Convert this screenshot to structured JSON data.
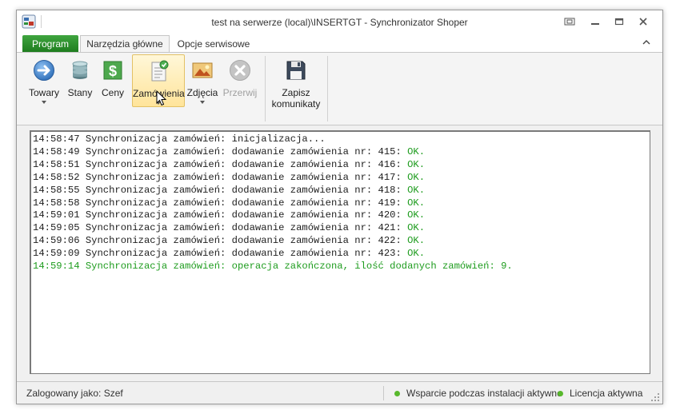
{
  "window": {
    "title": "test na serwerze (local)\\INSERTGT - Synchronizator Shoper"
  },
  "tabs": {
    "program": "Program",
    "main": "Narzędzia główne",
    "service": "Opcje serwisowe"
  },
  "ribbon": {
    "towary": "Towary",
    "stany": "Stany",
    "ceny": "Ceny",
    "zamowienia": "Zamówienia",
    "zdjecia": "Zdjęcia",
    "przerwij": "Przerwij",
    "zapisz_line1": "Zapisz",
    "zapisz_line2": "komunikaty"
  },
  "log": {
    "lines": [
      {
        "text": "14:58:47 Synchronizacja zamówień: inicjalizacja...",
        "status": ""
      },
      {
        "text": "14:58:49 Synchronizacja zamówień: dodawanie zamówienia nr: 415: ",
        "status": "OK."
      },
      {
        "text": "14:58:51 Synchronizacja zamówień: dodawanie zamówienia nr: 416: ",
        "status": "OK."
      },
      {
        "text": "14:58:52 Synchronizacja zamówień: dodawanie zamówienia nr: 417: ",
        "status": "OK."
      },
      {
        "text": "14:58:55 Synchronizacja zamówień: dodawanie zamówienia nr: 418: ",
        "status": "OK."
      },
      {
        "text": "14:58:58 Synchronizacja zamówień: dodawanie zamówienia nr: 419: ",
        "status": "OK."
      },
      {
        "text": "14:59:01 Synchronizacja zamówień: dodawanie zamówienia nr: 420: ",
        "status": "OK."
      },
      {
        "text": "14:59:05 Synchronizacja zamówień: dodawanie zamówienia nr: 421: ",
        "status": "OK."
      },
      {
        "text": "14:59:06 Synchronizacja zamówień: dodawanie zamówienia nr: 422: ",
        "status": "OK."
      },
      {
        "text": "14:59:09 Synchronizacja zamówień: dodawanie zamówienia nr: 423: ",
        "status": "OK."
      }
    ],
    "final": "14:59:14 Synchronizacja zamówień: operacja zakończona, ilość dodanych zamówień: 9."
  },
  "status": {
    "user": "Zalogowany jako: Szef",
    "support": "Wsparcie podczas instalacji aktywne",
    "license": "Licencja aktywna"
  },
  "colors": {
    "program_tab": "#2a8f2a",
    "ok_text": "#1e9c1e",
    "status_dot": "#58b82c",
    "highlight": "#ffe49a"
  }
}
